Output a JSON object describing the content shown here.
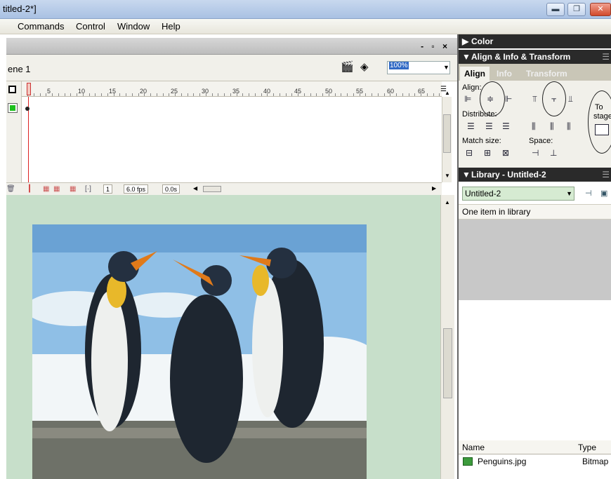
{
  "window": {
    "title": "titled-2*]"
  },
  "menu": {
    "items": [
      "Commands",
      "Control",
      "Window",
      "Help"
    ]
  },
  "timeline": {
    "panel_controls": "- ▫ ×",
    "scene": "ene 1",
    "zoom": "100%",
    "ruler_ticks": [
      "5",
      "10",
      "15",
      "20",
      "25",
      "30",
      "35",
      "40",
      "45",
      "50",
      "55",
      "60",
      "65"
    ],
    "current_frame": "1",
    "fps": "6.0 fps",
    "elapsed": "0.0s"
  },
  "panels": {
    "color_title": "Color",
    "align_title": "Align & Info & Transform",
    "tabs": [
      "Align",
      "Info",
      "Transform"
    ],
    "align": {
      "align_label": "Align:",
      "distribute_label": "Distribute:",
      "match_label": "Match size:",
      "space_label": "Space:",
      "to_stage_1": "To",
      "to_stage_2": "stage"
    },
    "library_title": "Library - Untitled-2",
    "library": {
      "document": "Untitled-2",
      "count": "One item in library",
      "col_name": "Name",
      "col_type": "Type",
      "item_name": "Penguins.jpg",
      "item_type": "Bitmap"
    }
  },
  "colors": {
    "stage": "#c7dfca",
    "panel_header": "#2a2a2a",
    "accent": "#316ac5"
  }
}
